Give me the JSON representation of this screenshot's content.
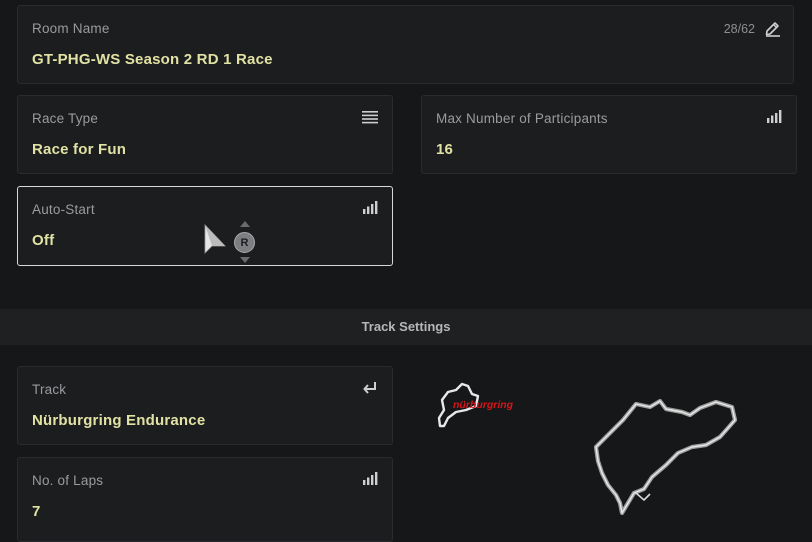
{
  "room_name": {
    "label": "Room Name",
    "value": "GT-PHG-WS Season 2 RD 1 Race",
    "char_count": "28/62",
    "icon": "pencil-icon"
  },
  "race_type": {
    "label": "Race Type",
    "value": "Race for Fun",
    "icon": "list-icon"
  },
  "max_participants": {
    "label": "Max Number of Participants",
    "value": "16",
    "icon": "signal-bars-icon"
  },
  "auto_start": {
    "label": "Auto-Start",
    "value": "Off",
    "icon": "signal-bars-icon",
    "button_hint": "R"
  },
  "track_settings": {
    "title": "Track Settings"
  },
  "track": {
    "label": "Track",
    "value": "Nürburgring Endurance",
    "icon": "return-icon",
    "logo_text": "nürburgring"
  },
  "laps": {
    "label": "No. of Laps",
    "value": "7",
    "icon": "signal-bars-icon"
  },
  "colors": {
    "background": "#161718",
    "panel": "#1c1d1f",
    "value_text": "#e2e2a4",
    "label_text": "#9a9b9e",
    "logo_red": "#d4161c"
  }
}
